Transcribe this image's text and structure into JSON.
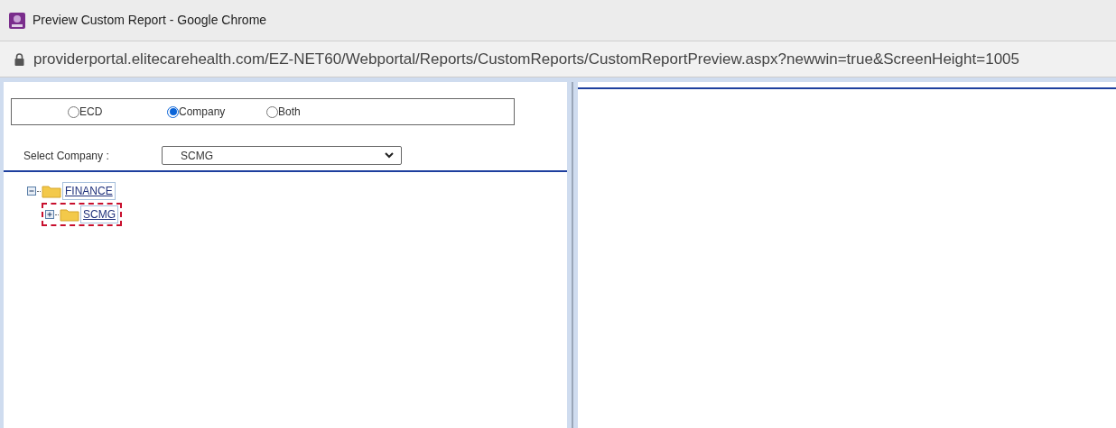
{
  "window": {
    "title": "Preview Custom Report - Google Chrome"
  },
  "address_bar": {
    "url": "providerportal.elitecarehealth.com/EZ-NET60/Webportal/Reports/CustomReports/CustomReportPreview.aspx?newwin=true&ScreenHeight=1005"
  },
  "radio_options": [
    {
      "label": "ECD",
      "selected": false
    },
    {
      "label": "Company",
      "selected": true
    },
    {
      "label": "Both",
      "selected": false
    }
  ],
  "company_select": {
    "label": "Select Company :",
    "value": "SCMG"
  },
  "tree": [
    {
      "label": "FINANCE",
      "expanded": true,
      "selected": false,
      "children": [
        {
          "label": "SCMG",
          "expanded": false,
          "selected": true
        }
      ]
    }
  ]
}
